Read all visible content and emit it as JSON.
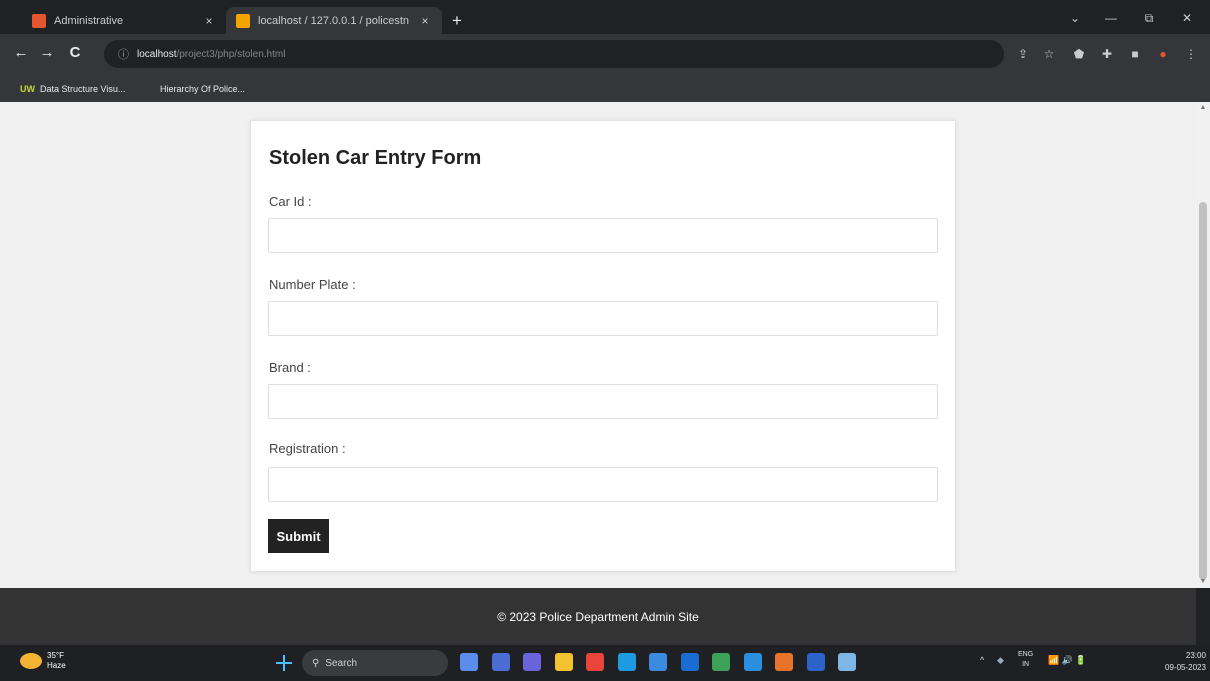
{
  "browser": {
    "tabs": [
      {
        "title": "Administrative",
        "close": "×",
        "favicon_color": "#e4572e"
      },
      {
        "title": "localhost / 127.0.0.1 / policestn",
        "close": "×",
        "favicon_color": "#f4a300"
      }
    ],
    "new_tab": "+",
    "window_controls": {
      "dropdown": "⌄",
      "minimize": "—",
      "restore": "⧉",
      "close": "✕"
    },
    "nav": {
      "back": "←",
      "forward": "→",
      "reload": "C"
    },
    "address": {
      "host": "localhost",
      "path": "/project3/php/stolen.html",
      "info": "ⓘ"
    },
    "toolbar_icons": [
      "share-icon",
      "star-icon",
      "shield-icon",
      "extensions-icon",
      "sidebar-icon",
      "profile-icon",
      "menu-icon"
    ],
    "bookmarks": [
      {
        "icon": "UW",
        "label": "Data Structure Visu..."
      },
      {
        "icon": "",
        "label": "Hierarchy Of Police..."
      }
    ]
  },
  "form": {
    "title": "Stolen Car Entry Form",
    "fields": [
      {
        "label": "Car Id :",
        "value": ""
      },
      {
        "label": "Number Plate :",
        "value": ""
      },
      {
        "label": "Brand :",
        "value": ""
      },
      {
        "label": "Registration :",
        "value": ""
      }
    ],
    "submit_label": "Submit"
  },
  "footer": {
    "text": "© 2023 Police Department Admin Site"
  },
  "taskbar": {
    "weather": {
      "temp": "35°F",
      "condition": "Haze"
    },
    "search_placeholder": "Search",
    "apps": [
      {
        "name": "taskview-app",
        "color": "#5b8def"
      },
      {
        "name": "explorer-app",
        "color": "#4a6cd4"
      },
      {
        "name": "chat-app",
        "color": "#6b63d9"
      },
      {
        "name": "files-app",
        "color": "#f2c230"
      },
      {
        "name": "chrome-app",
        "color": "#e9453a"
      },
      {
        "name": "edge-app",
        "color": "#1e9be0"
      },
      {
        "name": "store-app",
        "color": "#3b8be0"
      },
      {
        "name": "outlook-app",
        "color": "#1b6bd4"
      },
      {
        "name": "chrome-alt-app",
        "color": "#3ca25a"
      },
      {
        "name": "vscode-app",
        "color": "#2b8fe0"
      },
      {
        "name": "xampp-app",
        "color": "#e8742b"
      },
      {
        "name": "word-app",
        "color": "#2c63c8"
      },
      {
        "name": "notepad-app",
        "color": "#7db7e8"
      }
    ],
    "tray": {
      "chevron": "^",
      "lang_top": "ENG",
      "lang_bottom": "IN",
      "icons": "📶 🔊 🔋"
    },
    "clock": {
      "time": "23:00",
      "date": "09-05-2023"
    }
  }
}
